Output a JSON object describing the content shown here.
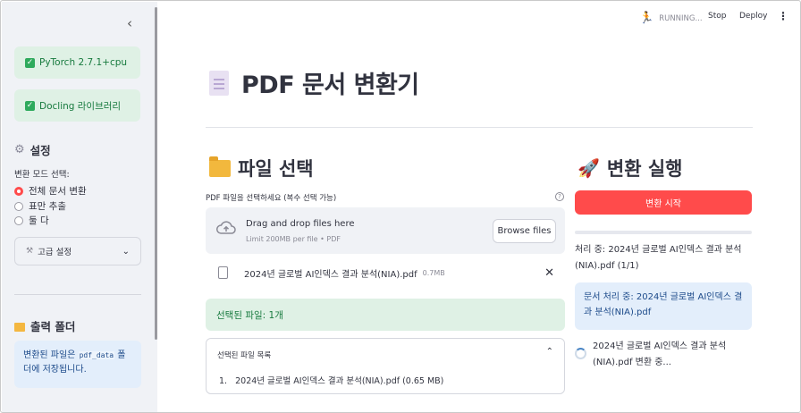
{
  "header": {
    "status": "RUNNING...",
    "stop_label": "Stop",
    "deploy_label": "Deploy",
    "menu_icon": "kebab-menu-icon"
  },
  "sidebar": {
    "collapse_icon": "chevron-left-icon",
    "status_boxes": [
      {
        "label": "PyTorch 2.7.1+cpu"
      },
      {
        "label": "Docling 라이브러리"
      }
    ],
    "settings_title": "설정",
    "mode_label": "변환 모드 선택:",
    "modes": [
      {
        "label": "전체 문서 변환",
        "selected": true
      },
      {
        "label": "표만 추출",
        "selected": false
      },
      {
        "label": "둘 다",
        "selected": false
      }
    ],
    "advanced_label": "고급 설정",
    "output_title": "출력 폴더",
    "output_info_pre": "변환된 파일은 ",
    "output_info_code": "pdf_data",
    "output_info_post": " 폴더에 저장됩니다."
  },
  "main": {
    "title": "PDF 문서 변환기",
    "file_section_title": "파일 선택",
    "run_section_title": "변환 실행",
    "uploader_label": "PDF 파일을 선택하세요 (복수 선택 가능)",
    "dropzone_title": "Drag and drop files here",
    "dropzone_limit": "Limit 200MB per file • PDF",
    "browse_label": "Browse files",
    "uploaded_file": {
      "name": "2024년 글로벌 AI인덱스 결과 분석(NIA).pdf",
      "size": "0.7MB"
    },
    "selected_count": "선택된 파일: 1개",
    "expander_title": "선택된 파일 목록",
    "file_list": [
      "2024년 글로벌 AI인덱스 결과 분석(NIA).pdf (0.65 MB)"
    ],
    "start_button": "변환 시작",
    "progress": 0,
    "processing_text": "처리 중: 2024년 글로벌 AI인덱스 결과 분석(NIA).pdf (1/1)",
    "processing_info": "문서 처리 중: 2024년 글로벌 AI인덱스 결과 분석(NIA).pdf",
    "spinner_text": "2024년 글로벌 AI인덱스 결과 분석(NIA).pdf 변환 중..."
  },
  "colors": {
    "primary": "#ff4b4b",
    "success_bg": "#dff1e5",
    "info_bg": "#e3eefb",
    "sidebar_bg": "#f0f2f6"
  }
}
